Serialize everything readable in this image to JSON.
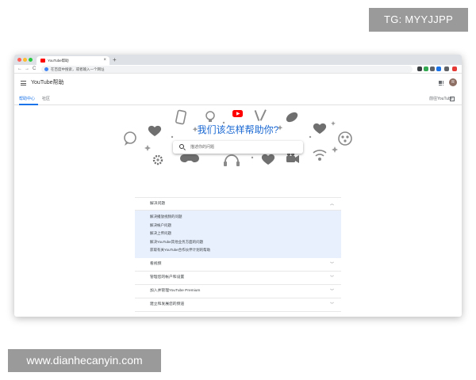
{
  "watermarks": {
    "top": "TG: MYYJJPP",
    "bottom": "www.dianhecanyin.com"
  },
  "browser": {
    "tab_title": "YouTube帮助",
    "tab_close": "×",
    "new_tab": "+",
    "address_text": "在百度中搜索，或者输入一个网址",
    "nav": {
      "back": "←",
      "forward": "→",
      "reload": "C"
    },
    "extension_colors": [
      "#3c4043",
      "#34a853",
      "#5f6368",
      "#1a73e8",
      "#5f6368",
      "#e53935"
    ]
  },
  "header": {
    "title": "YouTube帮助",
    "avatar_letter": "R"
  },
  "subnav": {
    "tabs": [
      {
        "label": "帮助中心",
        "active": true
      },
      {
        "label": "社区",
        "active": false
      }
    ],
    "to_youtube": "前往YouTube"
  },
  "hero": {
    "headline": "我们该怎样帮助你?",
    "search_placeholder": "描述你的问题"
  },
  "faq": {
    "expanded": {
      "title": "解决问题",
      "items": [
        "解决播放视频的问题",
        "解决帐户问题",
        "解决上传问题",
        "解决YouTube其他业务方面的问题",
        "获取有关YouTube合作伙伴计划的帮助"
      ]
    },
    "sections": [
      "看视频",
      "管理您的帐户和设置",
      "加入并管理YouTube Premium",
      "建立和发展您的频道"
    ]
  },
  "colors": {
    "accent": "#1a73e8",
    "headline": "#1967d2",
    "youtube_red": "#ff0000",
    "illustration_gray": "#8a8a8a",
    "panel_bg": "#e8f0fe"
  }
}
